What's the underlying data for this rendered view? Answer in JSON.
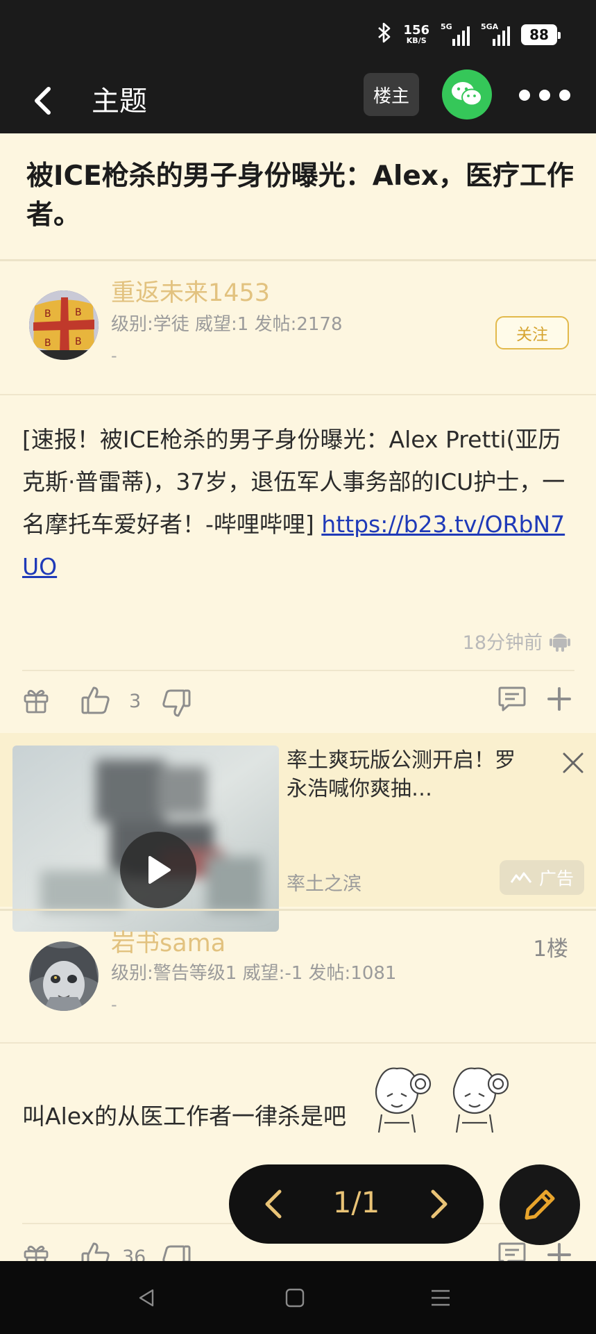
{
  "status_bar": {
    "net_speed": "156",
    "net_speed_unit": "KB/S",
    "sim1_label": "5G",
    "sim2_label": "5GA",
    "battery": "88",
    "icons": [
      "bluetooth-icon",
      "signal-icon",
      "battery-icon"
    ]
  },
  "nav": {
    "title": "主题",
    "op_only_label": "楼主",
    "icons": [
      "back-arrow-icon",
      "wechat-icon",
      "more-icon"
    ]
  },
  "thread": {
    "title": "被ICE枪杀的男子身份曝光：Alex，医疗工作者。"
  },
  "post": {
    "author": "重返未来1453",
    "meta": "级别:学徒 威望:1 发帖:2178",
    "signature": "-",
    "follow_label": "关注",
    "body_text": "[速报！被ICE枪杀的男子身份曝光：Alex Pretti(亚历克斯·普雷蒂)，37岁，退伍军人事务部的ICU护士，一名摩托车爱好者！-哔哩哔哩] ",
    "link_text": "https://b23.tv/ORbN7UO",
    "time": "18分钟前",
    "like_count": "3"
  },
  "ad": {
    "title": "率土爽玩版公测开启！罗永浩喊你爽抽…",
    "source": "率土之滨",
    "badge": "广告"
  },
  "reply": {
    "author": "岩书sama",
    "floor": "1楼",
    "meta": "级别:警告等级1 威望:-1 发帖:1081",
    "signature": "-",
    "body_text": "叫Alex的从医工作者一律杀是吧",
    "like_count": "36"
  },
  "pager": {
    "text": "1/1"
  },
  "colors": {
    "page_bg": "#fdf6e0",
    "topbar_bg": "#1b1b1b",
    "author_name": "#e2c27f",
    "accent_gold": "#e2b94b",
    "link": "#1f3ab8",
    "wechat_green": "#35c759"
  }
}
